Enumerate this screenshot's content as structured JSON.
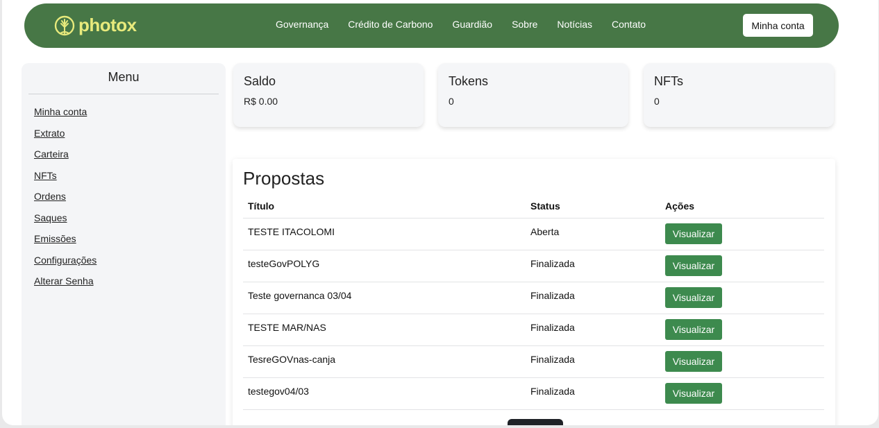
{
  "brand": {
    "name": "photox",
    "color": "#e8ea7c",
    "icon": "tree-icon"
  },
  "nav": {
    "links": [
      "Governança",
      "Crédito de Carbono",
      "Guardião",
      "Sobre",
      "Notícias",
      "Contato"
    ],
    "account_label": "Minha conta",
    "bg_color": "#477746"
  },
  "sidebar": {
    "title": "Menu",
    "items": [
      {
        "label": "Minha conta"
      },
      {
        "label": "Extrato"
      },
      {
        "label": "Carteira"
      },
      {
        "label": "NFTs"
      },
      {
        "label": "Ordens"
      },
      {
        "label": "Saques"
      },
      {
        "label": "Emissões"
      },
      {
        "label": "Configurações"
      },
      {
        "label": "Alterar Senha"
      }
    ]
  },
  "cards": [
    {
      "title": "Saldo",
      "value": "R$ 0.00"
    },
    {
      "title": "Tokens",
      "value": "0"
    },
    {
      "title": "NFTs",
      "value": "0"
    }
  ],
  "proposals": {
    "title": "Propostas",
    "columns": [
      "Título",
      "Status",
      "Ações"
    ],
    "action_label": "Visualizar",
    "action_color": "#3d8a4e",
    "rows": [
      {
        "title": "TESTE ITACOLOMI",
        "status": "Aberta"
      },
      {
        "title": "testeGovPOLYG",
        "status": "Finalizada"
      },
      {
        "title": "Teste governanca 03/04",
        "status": "Finalizada"
      },
      {
        "title": "TESTE MAR/NAS",
        "status": "Finalizada"
      },
      {
        "title": "TesreGOVnas-canja",
        "status": "Finalizada"
      },
      {
        "title": "testegov04/03",
        "status": "Finalizada"
      }
    ]
  }
}
